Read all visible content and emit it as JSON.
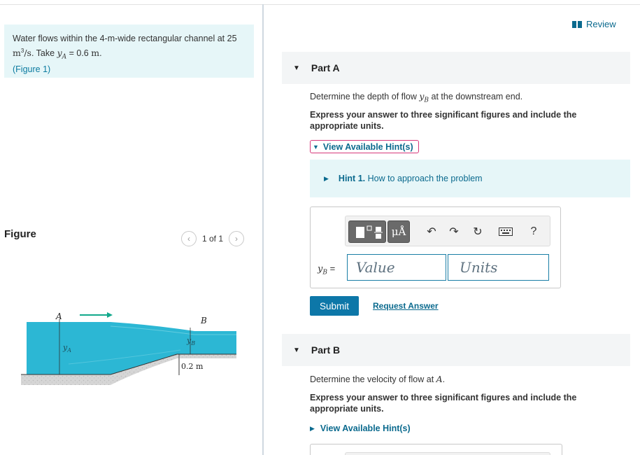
{
  "problem": {
    "text_before": "Water flows within the 4-m-wide rectangular channel at 25 ",
    "flow_unit": "m",
    "flow_unit_exp": "3",
    "flow_unit_tail": "/s",
    "take_text": ". Take ",
    "ya_symbol": "y",
    "ya_sub": "A",
    "ya_value": " = 0.6 ",
    "ya_unit": "m",
    "period": ".",
    "figure_link": "(Figure 1)"
  },
  "figure_panel": {
    "title": "Figure",
    "pager_text": "1 of 1",
    "prev_icon": "chevron-left-icon",
    "next_icon": "chevron-right-icon",
    "labels": {
      "A": "A",
      "B": "B",
      "yA": "y",
      "yA_sub": "A",
      "yB": "y",
      "yB_sub": "B",
      "step": "0.2 m"
    },
    "colors": {
      "water": "#2cb7d4",
      "ground": "#d9d9d9",
      "arrow": "#12a98c"
    }
  },
  "review": {
    "label": "Review",
    "icon": "book-icon"
  },
  "part_a": {
    "label": "Part A",
    "question_before": "Determine the depth of flow ",
    "q_sym": "y",
    "q_sub": "B",
    "question_after": " at the downstream end.",
    "instruction": "Express your answer to three significant figures and include the appropriate units.",
    "hint_toggle": "View Available Hint(s)",
    "hint_number": "Hint 1.",
    "hint_title": "How to approach the problem",
    "toolbar": {
      "units_button": "μÅ",
      "help": "?"
    },
    "var_symbol": "y",
    "var_sub": "B",
    "var_eq": " =",
    "value_placeholder": "Value",
    "units_placeholder": "Units",
    "submit": "Submit",
    "request": "Request Answer"
  },
  "part_b": {
    "label": "Part B",
    "question_before": "Determine the velocity of flow at ",
    "q_sym": "A",
    "question_after": ".",
    "instruction": "Express your answer to three significant figures and include the appropriate units.",
    "hint_toggle": "View Available Hint(s)"
  },
  "colors": {
    "accent": "#0b6a8e",
    "submit_bg": "#0d77a8",
    "hint_bg": "#e6f6f8",
    "focus_outline": "#d6387a"
  }
}
